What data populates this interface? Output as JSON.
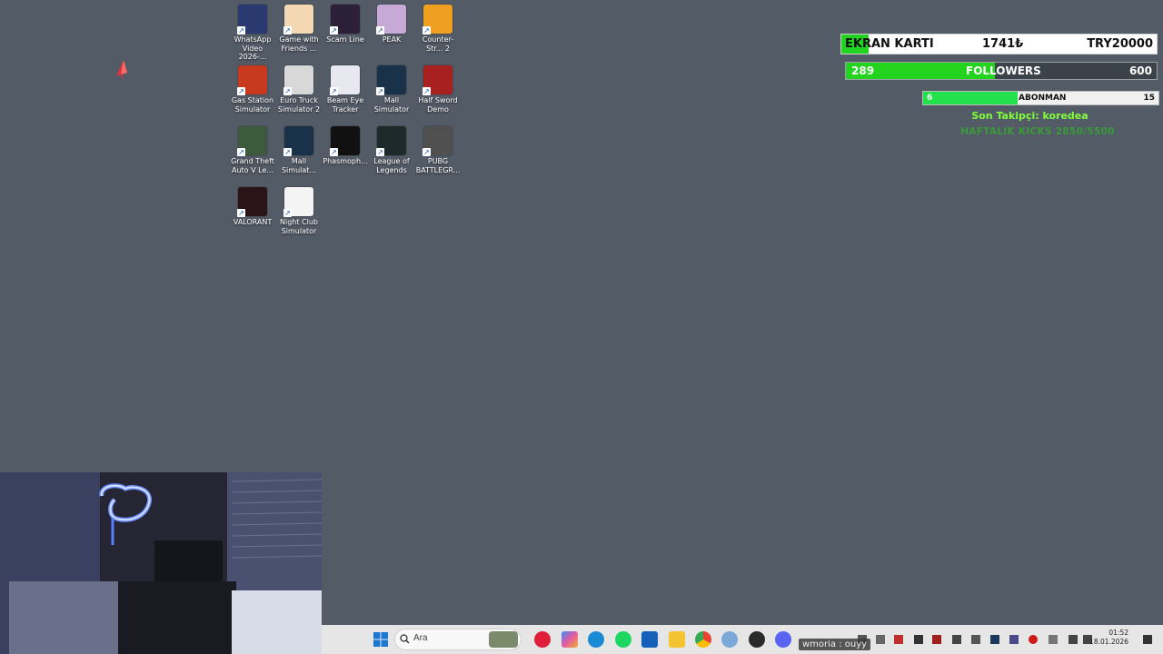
{
  "desktop_icons": [
    {
      "label": "WhatsApp Video 2026-...",
      "icon": "video-file-icon",
      "color": "#2a3a70"
    },
    {
      "label": "Game with Friends ...",
      "icon": "game-with-friends-icon",
      "color": "#f4d8b4"
    },
    {
      "label": "Scam Line",
      "icon": "scam-line-icon",
      "color": "#2b2038"
    },
    {
      "label": "PEAK",
      "icon": "peak-icon",
      "color": "#c7a9d8"
    },
    {
      "label": "Counter-Str... 2",
      "icon": "counter-strike-icon",
      "color": "#f0a020"
    },
    {
      "label": "Gas Station Simulator",
      "icon": "gas-station-icon",
      "color": "#c83a1e"
    },
    {
      "label": "Euro Truck Simulator 2",
      "icon": "euro-truck-icon",
      "color": "#d8d8d8"
    },
    {
      "label": "Beam Eye Tracker",
      "icon": "beam-eye-icon",
      "color": "#e8e8f0"
    },
    {
      "label": "Mall Simulator",
      "icon": "mall-simulator-icon",
      "color": "#19324a"
    },
    {
      "label": "Half Sword Demo",
      "icon": "half-sword-icon",
      "color": "#a82020"
    },
    {
      "label": "Grand Theft Auto V Le...",
      "icon": "gta-icon",
      "color": "#3c5a3c"
    },
    {
      "label": "Mall Simulat...",
      "icon": "mall-simulator-icon",
      "color": "#19324a"
    },
    {
      "label": "Phasmoph...",
      "icon": "phasmophobia-icon",
      "color": "#111111"
    },
    {
      "label": "League of Legends",
      "icon": "league-icon",
      "color": "#1c2a2a"
    },
    {
      "label": "PUBG BATTLEGR...",
      "icon": "pubg-icon",
      "color": "#505050"
    },
    {
      "label": "VALORANT",
      "icon": "valorant-icon",
      "color": "#2a1418"
    },
    {
      "label": "Night Club Simulator",
      "icon": "night-club-icon",
      "color": "#f4f4f4"
    }
  ],
  "overlay": {
    "goal_gpu": {
      "left": "EKRAN KARTI",
      "current": "1741₺",
      "target": "TRY20000",
      "progress": 0.087
    },
    "goal_followers": {
      "current": "289",
      "label": "FOLLOWERS",
      "target": "600",
      "progress": 0.48
    },
    "goal_subs": {
      "current": "6",
      "label": "ABONMAN",
      "target": "15",
      "progress": 0.4
    },
    "last_follower": "Son Takipçi: koredea",
    "weekly_kicks": "HAFTALIK KICKS 2850/5500"
  },
  "taskbar": {
    "search_placeholder": "Ara",
    "clock_time": "01:52",
    "clock_date": "18.01.2026",
    "chat_message": "wmoria : ouyy"
  },
  "colors": {
    "desktop_bg": "#535b67",
    "goal_green": "#22d322",
    "accent_green_text": "#7fff3a"
  }
}
